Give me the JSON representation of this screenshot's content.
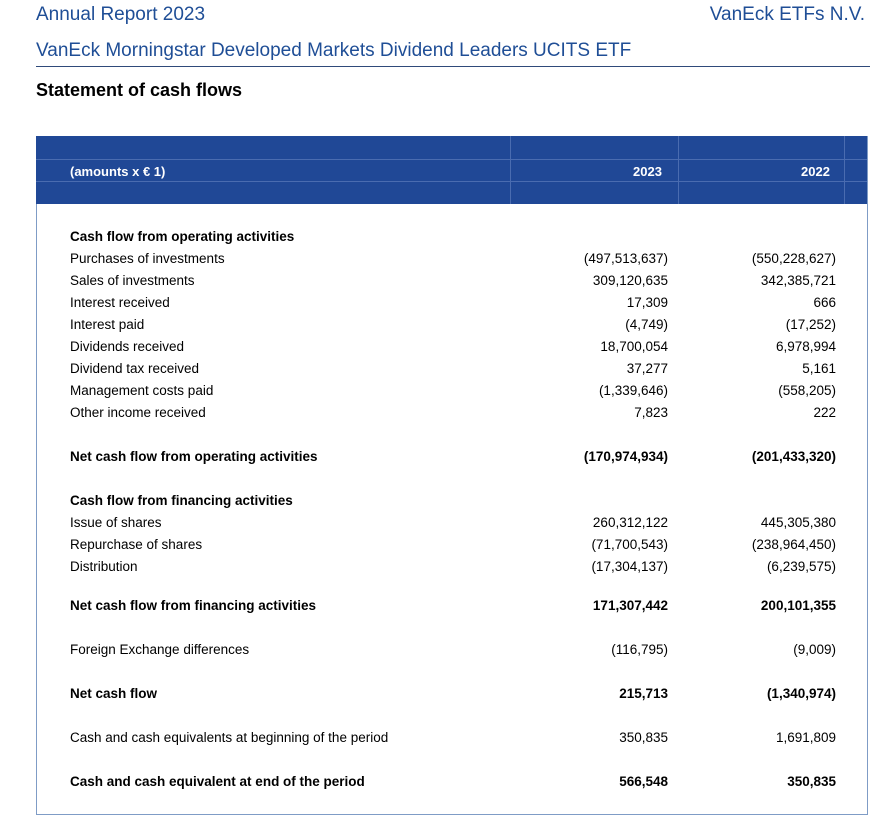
{
  "header": {
    "report_title": "Annual Report 2023",
    "company": "VanEck ETFs N.V.",
    "fund_name": "VanEck Morningstar Developed Markets Dividend Leaders UCITS ETF"
  },
  "statement_title": "Statement of cash flows",
  "table": {
    "columns": [
      "(amounts x € 1)",
      "2023",
      "2022"
    ],
    "rows": [
      {
        "label": "Cash flow from operating activities",
        "v2023": "",
        "v2022": ""
      },
      {
        "label": "Purchases of investments",
        "v2023": "(497,513,637)",
        "v2022": "(550,228,627)"
      },
      {
        "label": "Sales of investments",
        "v2023": "309,120,635",
        "v2022": "342,385,721"
      },
      {
        "label": "Interest received",
        "v2023": "17,309",
        "v2022": "666"
      },
      {
        "label": "Interest paid",
        "v2023": "(4,749)",
        "v2022": "(17,252)"
      },
      {
        "label": "Dividends received",
        "v2023": "18,700,054",
        "v2022": "6,978,994"
      },
      {
        "label": "Dividend tax received",
        "v2023": "37,277",
        "v2022": "5,161"
      },
      {
        "label": "Management costs paid",
        "v2023": "(1,339,646)",
        "v2022": "(558,205)"
      },
      {
        "label": "Other income received",
        "v2023": "7,823",
        "v2022": "222"
      },
      {
        "label": "Net cash flow from operating activities",
        "v2023": "(170,974,934)",
        "v2022": "(201,433,320)"
      },
      {
        "label": "Cash flow from financing activities",
        "v2023": "",
        "v2022": ""
      },
      {
        "label": "Issue of shares",
        "v2023": "260,312,122",
        "v2022": "445,305,380"
      },
      {
        "label": "Repurchase of shares",
        "v2023": "(71,700,543)",
        "v2022": "(238,964,450)"
      },
      {
        "label": "Distribution",
        "v2023": "(17,304,137)",
        "v2022": "(6,239,575)"
      },
      {
        "label": "Net cash flow from financing activities",
        "v2023": "171,307,442",
        "v2022": "200,101,355"
      },
      {
        "label": "Foreign Exchange differences",
        "v2023": "(116,795)",
        "v2022": "(9,009)"
      },
      {
        "label": "Net cash flow",
        "v2023": "215,713",
        "v2022": "(1,340,974)"
      },
      {
        "label": "Cash and cash equivalents at beginning of the period",
        "v2023": "350,835",
        "v2022": "1,691,809"
      },
      {
        "label": "Cash and cash equivalent at end of the period",
        "v2023": "566,548",
        "v2022": "350,835"
      }
    ]
  }
}
